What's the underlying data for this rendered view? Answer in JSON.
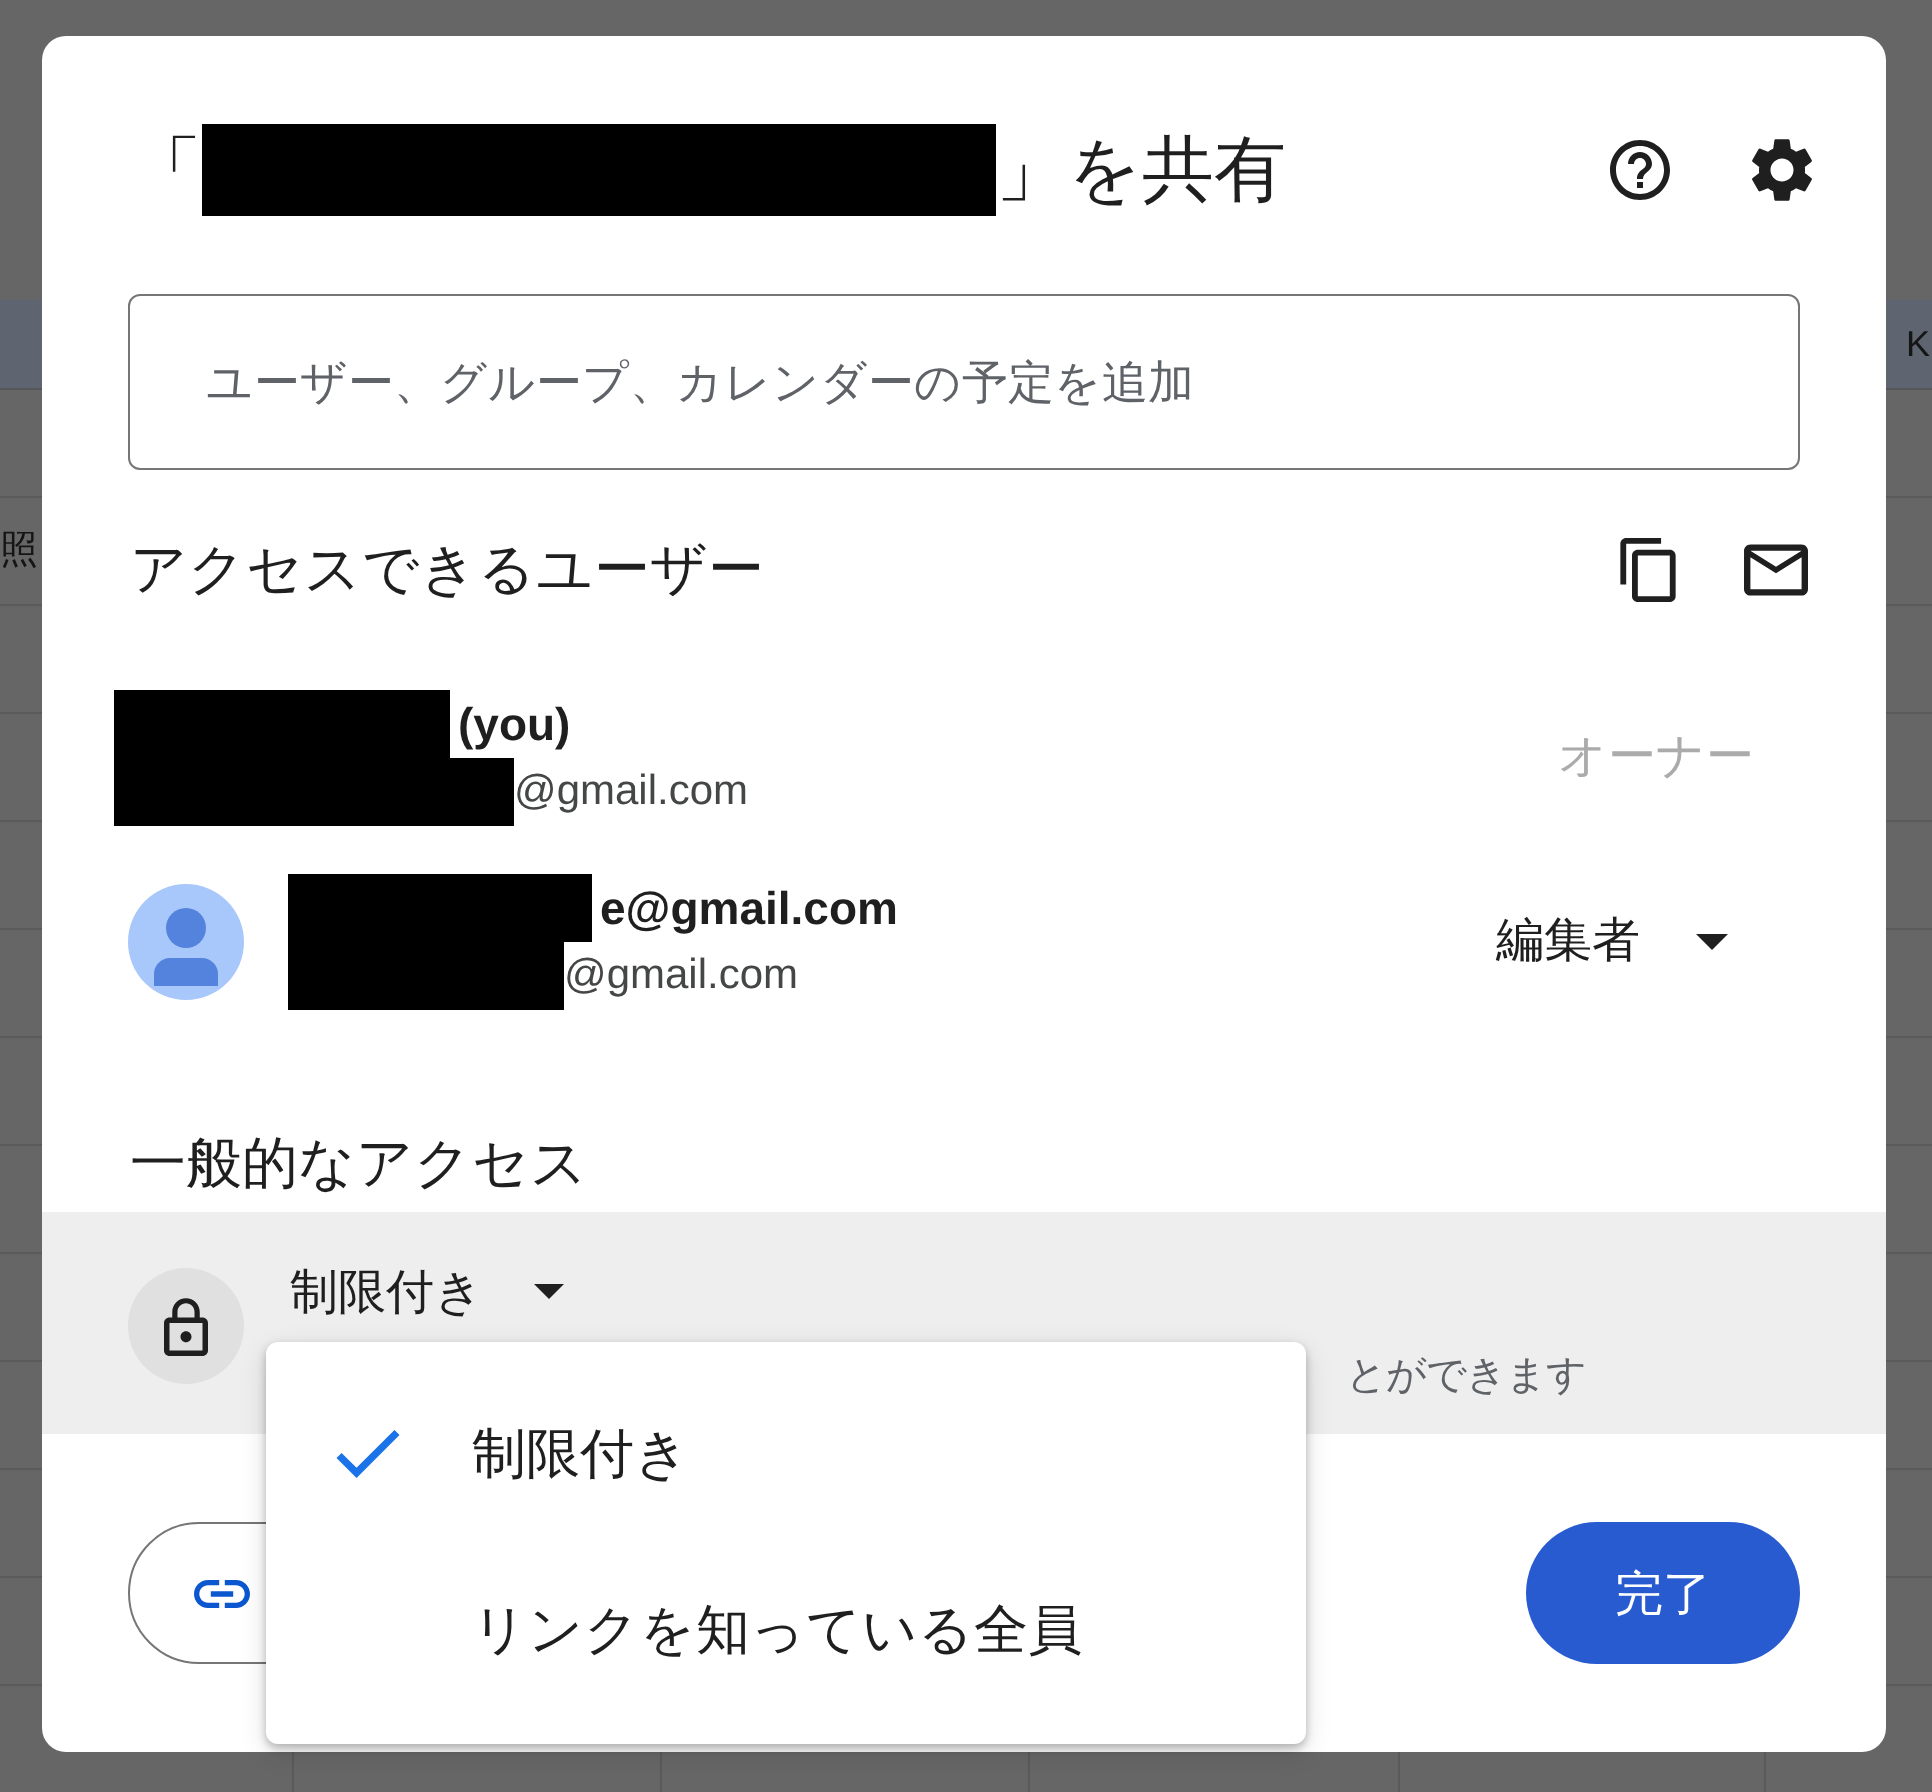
{
  "background_sheet": {
    "header_text": "K",
    "cell_text": "照"
  },
  "dialog": {
    "title": {
      "prefix": "「",
      "redacted": true,
      "suffix": "」を共有"
    },
    "add_field": {
      "placeholder": "ユーザー、グループ、カレンダーの予定を追加"
    },
    "people_heading": "アクセスできるユーザー",
    "people": [
      {
        "avatar_redacted": true,
        "redacted": true,
        "name": "(you)",
        "email": "@gmail.com",
        "role": {
          "label": "オーナー",
          "disabled": true
        }
      },
      {
        "avatar_redacted": false,
        "redacted": true,
        "name": "e@gmail.com",
        "email": "@gmail.com",
        "role": {
          "label": "編集者",
          "disabled": false
        }
      }
    ],
    "general_access": {
      "heading": "一般的なアクセス",
      "access_level": "制限付き",
      "description": "とができます",
      "menu": {
        "open": true,
        "options": [
          {
            "label": "制限付き",
            "selected": true
          },
          {
            "label": "リンクを知っている全員",
            "selected": false
          }
        ]
      }
    },
    "done_button": "完了"
  }
}
